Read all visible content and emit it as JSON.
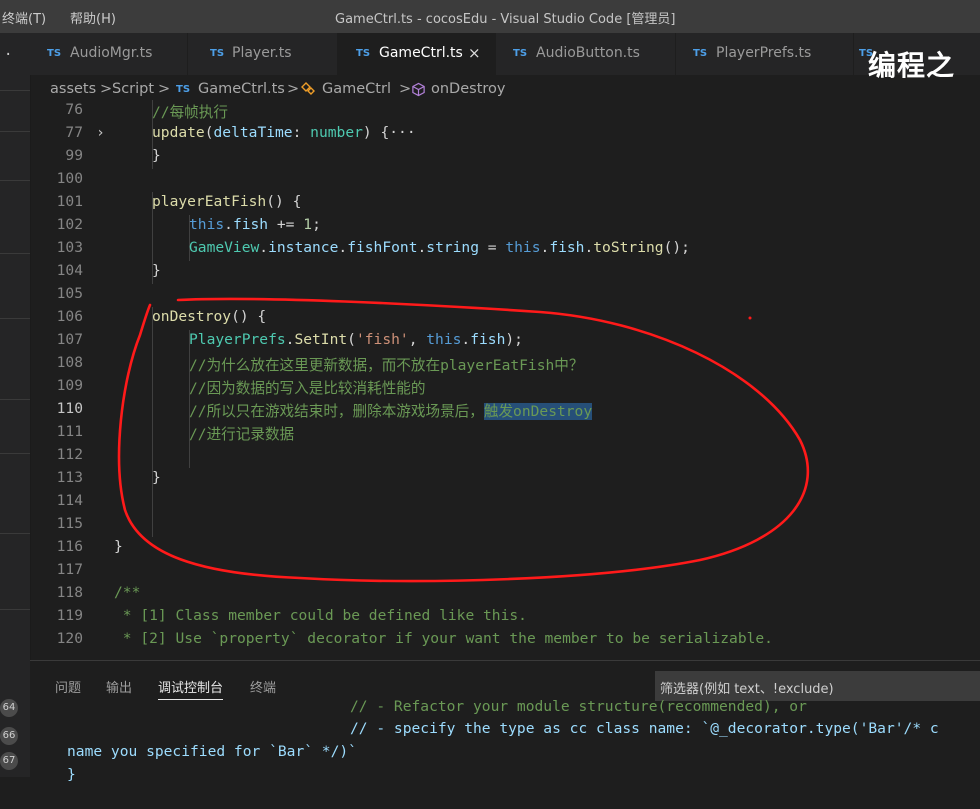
{
  "menu": [
    "终端(T)",
    "帮助(H)"
  ],
  "window_title": "GameCtrl.ts - cocosEdu - Visual Studio Code [管理员]",
  "tabs": [
    {
      "type": "TS",
      "label": "AudioMgr.ts"
    },
    {
      "type": "TS",
      "label": "Player.ts"
    },
    {
      "type": "TS",
      "label": "GameCtrl.ts",
      "active": true
    },
    {
      "type": "TS",
      "label": "AudioButton.ts"
    },
    {
      "type": "TS",
      "label": "PlayerPrefs.ts"
    },
    {
      "type": "TS",
      "label": ""
    }
  ],
  "tab_close": "×",
  "brand_watermark": "编程之",
  "breadcrumb": {
    "items": [
      "assets",
      "Script",
      "GameCtrl.ts",
      "GameCtrl",
      "onDestroy"
    ],
    "sep": ">",
    "file_type": "TS"
  },
  "editor": {
    "current_line": "110",
    "highlight_text": "触发onDestroy",
    "lines": [
      {
        "num": "76",
        "text": "//每帧执行"
      },
      {
        "num": "77",
        "text": "update(deltaTime: number) {···",
        "fold": "›"
      },
      {
        "num": "99",
        "text": "}"
      },
      {
        "num": "100",
        "text": ""
      },
      {
        "num": "101",
        "text": "playerEatFish() {"
      },
      {
        "num": "102",
        "text": "this.fish += 1;"
      },
      {
        "num": "103",
        "text": "GameView.instance.fishFont.string = this.fish.toString();"
      },
      {
        "num": "104",
        "text": "}"
      },
      {
        "num": "105",
        "text": ""
      },
      {
        "num": "106",
        "text": "onDestroy() {"
      },
      {
        "num": "107",
        "text": "PlayerPrefs.SetInt('fish', this.fish);"
      },
      {
        "num": "108",
        "text": "//为什么放在这里更新数据，而不放在playerEatFish中？"
      },
      {
        "num": "109",
        "text": "//因为数据的写入是比较消耗性能的"
      },
      {
        "num": "110",
        "text": "//所以只在游戏结束时，删除本游戏场景后，触发onDestroy"
      },
      {
        "num": "111",
        "text": "//进行记录数据"
      },
      {
        "num": "112",
        "text": ""
      },
      {
        "num": "113",
        "text": "}"
      },
      {
        "num": "114",
        "text": ""
      },
      {
        "num": "115",
        "text": ""
      },
      {
        "num": "116",
        "text": "}"
      },
      {
        "num": "117",
        "text": ""
      },
      {
        "num": "118",
        "text": "/**"
      },
      {
        "num": "119",
        "text": " * [1] Class member could be defined like this."
      },
      {
        "num": "120",
        "text": " * [2] Use `property` decorator if your want the member to be serializable."
      }
    ]
  },
  "panel": {
    "tabs": [
      "问题",
      "输出",
      "调试控制台",
      "终端"
    ],
    "active_tab": "调试控制台",
    "filter_placeholder": "筛选器(例如 text、!exclude)",
    "output": [
      "// - Refactor your module structure(recommended), or",
      "// - specify the type as cc class name: `@_decorator.type('Bar'/* c",
      "name you specified for `Bar` */)`",
      "}"
    ],
    "badges": [
      "64",
      "66",
      "67"
    ]
  },
  "colors": {
    "keyword": "#569cd6",
    "function": "#dcdcaa",
    "variable": "#9cdcfe",
    "type": "#4ec9b0",
    "number": "#b5cea8",
    "string": "#ce9178",
    "comment": "#6a9955",
    "annotation": "#ff1a1a"
  }
}
